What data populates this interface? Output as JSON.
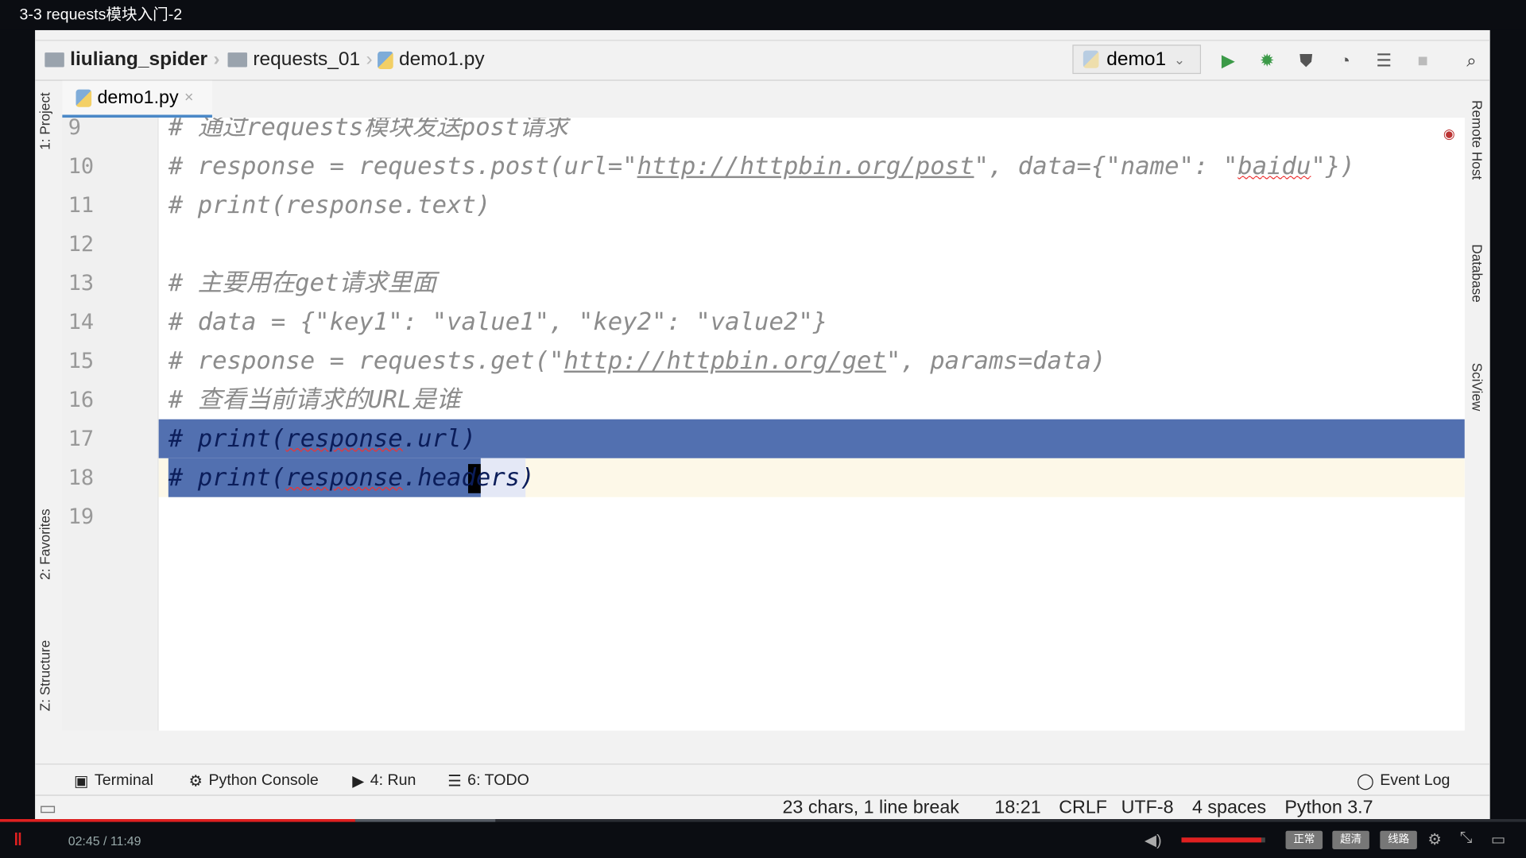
{
  "window_title": "3-3 requests模块入门-2",
  "breadcrumb": {
    "project": "liuliang_spider",
    "folder": "requests_01",
    "file": "demo1.py"
  },
  "run_config": "demo1",
  "tab": {
    "label": "demo1.py",
    "close": "×"
  },
  "left_tools": [
    "1: Project",
    "2: Favorites",
    "Z: Structure"
  ],
  "right_tools": [
    "Remote Host",
    "Database",
    "SciView"
  ],
  "code": [
    {
      "n": "9",
      "segs": [
        [
          "# 通过requests模块发送post请求",
          ""
        ]
      ]
    },
    {
      "n": "10",
      "segs": [
        [
          "# response = requests.post(url=\"",
          ""
        ],
        [
          "http://httpbin.org/post",
          "u"
        ],
        [
          "\", data={\"name\": \"",
          ""
        ],
        [
          "baidu",
          "sq"
        ],
        [
          "\"})",
          ""
        ]
      ]
    },
    {
      "n": "11",
      "segs": [
        [
          "# print(response.text)",
          ""
        ]
      ]
    },
    {
      "n": "12",
      "segs": []
    },
    {
      "n": "13",
      "segs": [
        [
          "# 主要用在get请求里面",
          ""
        ]
      ]
    },
    {
      "n": "14",
      "segs": [
        [
          "# data = {\"key1\": \"value1\", \"key2\": \"value2\"}",
          ""
        ]
      ]
    },
    {
      "n": "15",
      "segs": [
        [
          "# response = requests.get(\"",
          ""
        ],
        [
          "http://httpbin.org/get",
          "u"
        ],
        [
          "\", params=data)",
          ""
        ]
      ]
    },
    {
      "n": "16",
      "segs": [
        [
          "# 查看当前请求的URL是谁",
          ""
        ]
      ]
    },
    {
      "n": "17",
      "segs": [
        [
          "# ",
          "sel"
        ],
        [
          "print(",
          "sel"
        ],
        [
          "response",
          "sel sq"
        ],
        [
          ".url)",
          "sel"
        ]
      ]
    },
    {
      "n": "18",
      "segs": [
        [
          "# print(",
          "sel"
        ],
        [
          "response",
          "sel sq"
        ],
        [
          ".headers)",
          "sel"
        ]
      ]
    },
    {
      "n": "19",
      "segs": []
    }
  ],
  "bottom_tools": [
    "Terminal",
    "Python Console",
    "4: Run",
    "6: TODO",
    "Event Log"
  ],
  "status": {
    "selection": "23 chars, 1 line break",
    "position": "18:21",
    "line_sep": "CRLF",
    "encoding": "UTF-8",
    "indent": "4 spaces",
    "interpreter": "Python 3.7"
  },
  "player": {
    "time": "02:45 / 11:49",
    "progress": 0.233,
    "volume": 0.95,
    "buttons": [
      "正常",
      "超清",
      "线路"
    ]
  },
  "colors": {
    "selection": "#5270b0",
    "accent": "#4a88c7",
    "progress": "#e02020"
  }
}
